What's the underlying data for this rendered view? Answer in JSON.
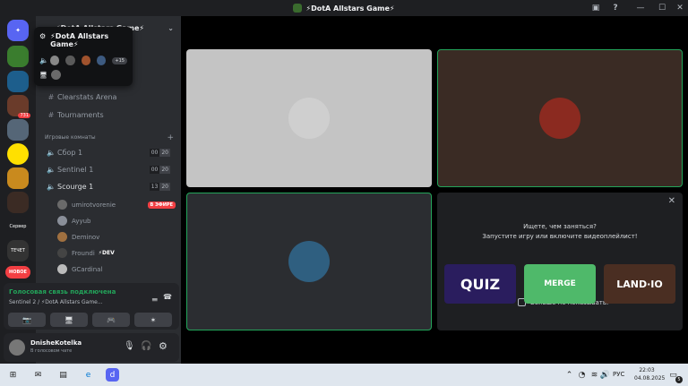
{
  "window": {
    "title": "⚡DotA Allstars Game⚡",
    "minimize": "—",
    "maximize": "☐",
    "close": "✕",
    "inbox": "▣",
    "help": "?"
  },
  "servers": [
    {
      "name": "server-home",
      "label": "",
      "color": "#5865f2"
    },
    {
      "name": "server-dota",
      "label": "",
      "color": "#3a7d2e"
    },
    {
      "name": "server-2",
      "label": "",
      "color": "#1d5e8c"
    },
    {
      "name": "server-3",
      "label": "",
      "badge": "731",
      "color": "#6a3b2a"
    },
    {
      "name": "server-4",
      "label": "",
      "color": "#556677"
    },
    {
      "name": "server-5",
      "label": "",
      "color": "#ffe000"
    },
    {
      "name": "server-6",
      "label": "",
      "color": "#c98a1e"
    },
    {
      "name": "server-7",
      "label": "",
      "color": "#3b2b24"
    },
    {
      "name": "server-text-1",
      "label": "Сервер",
      "color": "#1e1f22"
    },
    {
      "name": "server-text-2",
      "label": "ТЕЧЕТ",
      "color": "#333"
    },
    {
      "name": "server-new",
      "label": "НОВОЕ",
      "color": "#f23f43"
    }
  ],
  "sidebar": {
    "header": "⚡DotA Allstars Game⚡",
    "popup": {
      "title": "⚡DotA Allstars Game⚡",
      "count": "+15"
    },
    "channels": [
      {
        "label": "Clearstats Arena",
        "icon": "#"
      },
      {
        "label": "Tournaments",
        "icon": "#"
      }
    ],
    "category": "Игровые комнаты",
    "voice": [
      {
        "label": "Сбор 1",
        "a": "00",
        "b": "20"
      },
      {
        "label": "Sentinel 1",
        "a": "00",
        "b": "20"
      },
      {
        "label": "Scourge 1",
        "a": "13",
        "b": "20"
      }
    ],
    "users": [
      {
        "name": "umirotvorenie",
        "live": "В ЭФИРЕ",
        "color": "#6a6a6a"
      },
      {
        "name": "Ayyub",
        "color": "#8a8f99"
      },
      {
        "name": "Deminov",
        "color": "#a07040"
      },
      {
        "name": "Froundi",
        "tag": "⚡DEV",
        "color": "#444"
      },
      {
        "name": "GCardinal",
        "color": "#bbb"
      }
    ]
  },
  "voicepanel": {
    "status": "Голосовая связь подключена",
    "channel": "Sentinel 2 / ⚡DotA Allstars Game..."
  },
  "userbar": {
    "name": "DnisheKotelka",
    "status": "В голосовом чате"
  },
  "stage": {
    "tiles": [
      {
        "name": "video-tile-1",
        "bg": "#c4c4c4",
        "avatar": "#cfcfcf"
      },
      {
        "name": "video-tile-2",
        "bg": "#3a2b24",
        "avatar": "#8b2a20"
      },
      {
        "name": "video-tile-3",
        "bg": "#2b2d31",
        "avatar": "#2f5f80"
      }
    ],
    "activity": {
      "title": "Ищете, чем заняться?",
      "subtitle": "Запустите игру или включите видеоплейлист!",
      "checkbox": "Больше не показывать.",
      "games": [
        {
          "label": "QUIZ",
          "bg": "#2a1d5e"
        },
        {
          "label": "MERGE",
          "bg": "#4fb96a"
        },
        {
          "label": "LAND·IO",
          "bg": "#4a2e22"
        }
      ]
    }
  },
  "taskbar": {
    "lang": "РУС",
    "time": "22:03",
    "date": "04.08.2025",
    "notif": "5"
  }
}
